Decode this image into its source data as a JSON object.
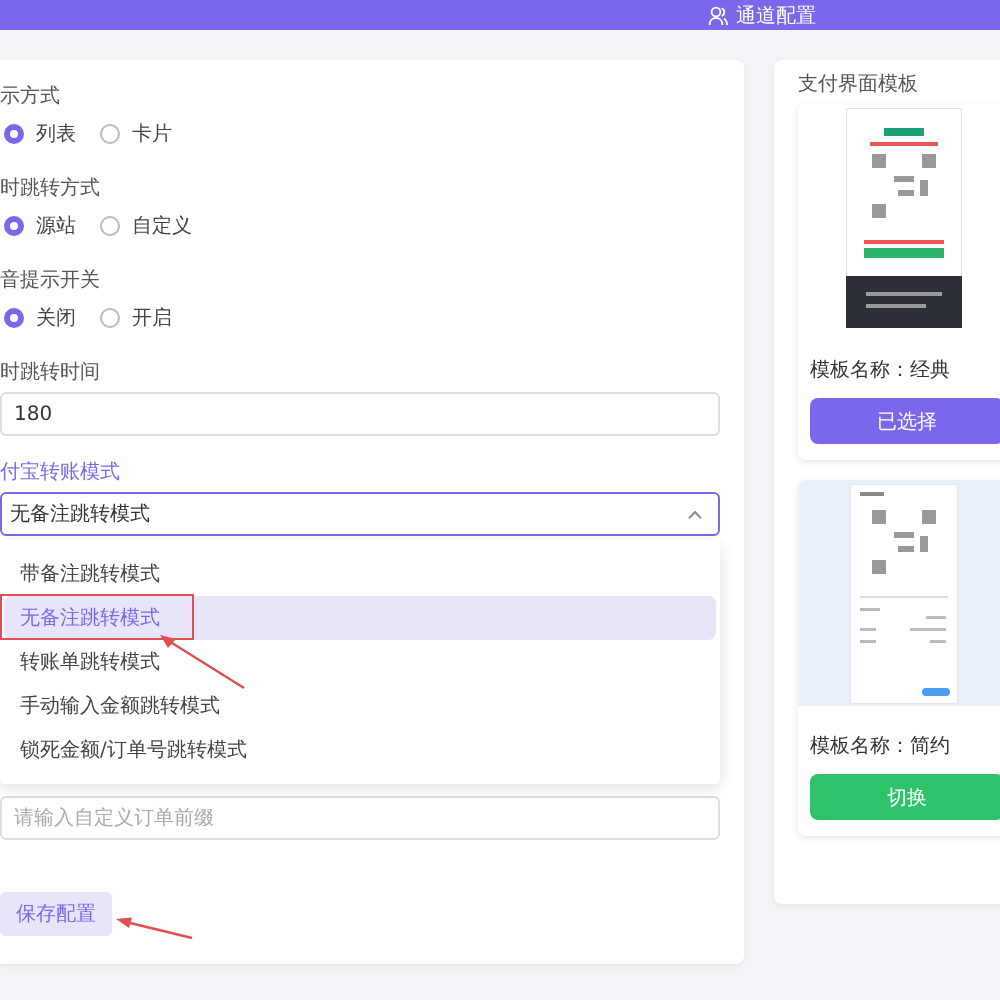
{
  "header": {
    "title": "通道配置"
  },
  "form": {
    "fields": [
      {
        "kind": "radio",
        "label": "示方式",
        "options": [
          {
            "label": "列表",
            "selected": true
          },
          {
            "label": "卡片",
            "selected": false
          }
        ]
      },
      {
        "kind": "radio",
        "label": "时跳转方式",
        "options": [
          {
            "label": "源站",
            "selected": true
          },
          {
            "label": "自定义",
            "selected": false
          }
        ]
      },
      {
        "kind": "radio",
        "label": "音提示开关",
        "options": [
          {
            "label": "关闭",
            "selected": true
          },
          {
            "label": "开启",
            "selected": false
          }
        ]
      },
      {
        "kind": "input",
        "label": "时跳转时间",
        "value": "180"
      },
      {
        "kind": "select",
        "label": "付宝转账模式",
        "value": "无备注跳转模式",
        "expanded": true,
        "options": [
          {
            "label": "带备注跳转模式",
            "selected": false
          },
          {
            "label": "无备注跳转模式",
            "selected": true
          },
          {
            "label": "转账单跳转模式",
            "selected": false
          },
          {
            "label": "手动输入金额跳转模式",
            "selected": false
          },
          {
            "label": "锁死金额/订单号跳转模式",
            "selected": false
          }
        ]
      },
      {
        "kind": "input",
        "placeholder": "请输入自定义订单前缀"
      }
    ],
    "save_button": "保存配置"
  },
  "templates": {
    "title": "支付界面模板",
    "items": [
      {
        "kind": "dark",
        "name": "模板名称：经典",
        "button": "已选择",
        "selected": true
      },
      {
        "kind": "light",
        "name": "模板名称：简约",
        "button": "切换",
        "selected": false
      }
    ]
  }
}
